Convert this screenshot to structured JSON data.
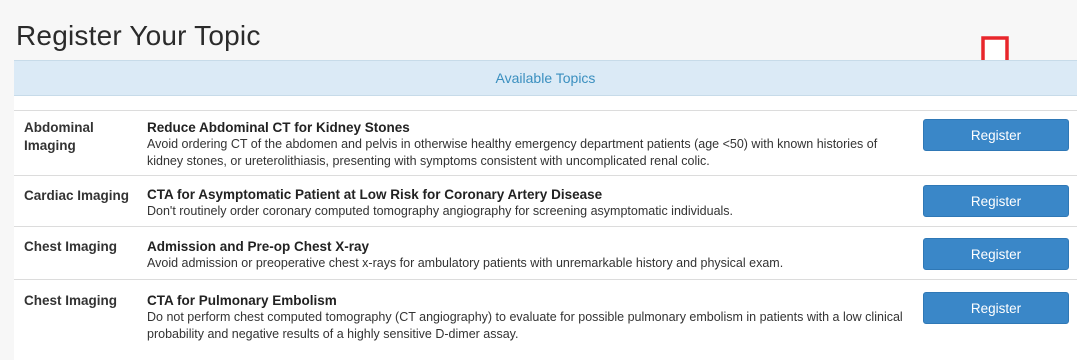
{
  "page": {
    "title": "Register Your Topic"
  },
  "panel": {
    "header": "Available Topics"
  },
  "colors": {
    "accent": "#3a87c8",
    "header_bg": "#dbeaf6",
    "header_text": "#3a8fbf",
    "arrow": "#e8262b"
  },
  "topics": [
    {
      "category": "Abdominal Imaging",
      "title": "Reduce Abdominal CT for Kidney Stones",
      "description": "Avoid ordering CT of the abdomen and pelvis in otherwise healthy emergency department patients (age <50) with known histories of kidney stones, or ureterolithiasis, presenting with symptoms consistent with uncomplicated renal colic.",
      "button": "Register"
    },
    {
      "category": "Cardiac Imaging",
      "title": "CTA for Asymptomatic Patient at Low Risk for Coronary Artery Disease",
      "description": "Don't routinely order coronary computed tomography angiography for screening asymptomatic individuals.",
      "button": "Register"
    },
    {
      "category": "Chest Imaging",
      "title": "Admission and Pre-op Chest X-ray",
      "description": "Avoid admission or preoperative chest x-rays for ambulatory patients with unremarkable history and physical exam.",
      "button": "Register"
    },
    {
      "category": "Chest Imaging",
      "title": "CTA for Pulmonary Embolism",
      "description": "Do not perform chest computed tomography (CT angiography) to evaluate for possible pulmonary embolism in patients with a low clinical probability and negative results of a highly sensitive D-dimer assay.",
      "button": "Register"
    }
  ],
  "icons": {
    "arrow": "down-arrow-icon"
  }
}
